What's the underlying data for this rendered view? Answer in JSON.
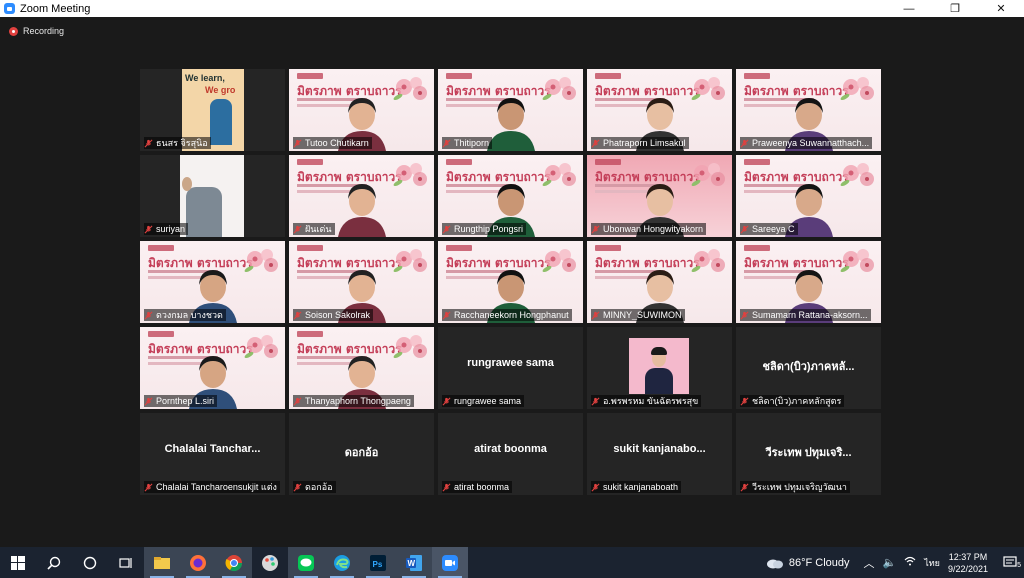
{
  "window": {
    "title": "Zoom Meeting",
    "controls": [
      "—",
      "❐",
      "✕"
    ]
  },
  "meeting": {
    "recording_label": "Recording"
  },
  "slide": {
    "title": "มิตรภาพ ตราบถาวร",
    "tile1_text_1": "We learn,",
    "tile1_text_2": "We gro"
  },
  "participants": [
    {
      "name": "ธนสร จิรสุนิอ",
      "type": "video-banner"
    },
    {
      "name": "Tutoo Chutikarn",
      "type": "slide"
    },
    {
      "name": "Thitiporn",
      "type": "slide"
    },
    {
      "name": "Phatraporn Limsakul",
      "type": "slide"
    },
    {
      "name": "Praweenya Suwannatthach...",
      "type": "slide"
    },
    {
      "name": "suriyan",
      "type": "video-dark"
    },
    {
      "name": "ฝันเด่น",
      "type": "slide"
    },
    {
      "name": "Rungthip  Pongsri",
      "type": "slide"
    },
    {
      "name": "Ubonwan Hongwityakorn",
      "type": "slide-pink"
    },
    {
      "name": "Sareeya C",
      "type": "slide"
    },
    {
      "name": "ดวงกมล บางชวด",
      "type": "slide"
    },
    {
      "name": "Soison Sakolrak",
      "type": "slide"
    },
    {
      "name": "Racchaneekorn Hongphanut",
      "type": "slide"
    },
    {
      "name": "MINNY_SUWIMON",
      "type": "slide"
    },
    {
      "name": "Sumamarn  Rattana-aksorn...",
      "type": "slide"
    },
    {
      "name": "Pornthep L.siri",
      "type": "slide"
    },
    {
      "name": "Thanyaphorn Thongpaeng",
      "type": "slide"
    },
    {
      "name": "rungrawee sama",
      "type": "nocam",
      "display": "rungrawee sama"
    },
    {
      "name": "อ.พรพรหม ขันฉัตรพรสุข",
      "type": "photo"
    },
    {
      "name": "ชลิดา(บิว)ภาคหลักสูตร",
      "type": "nocam",
      "display": "ชลิดา(บิว)ภาคหลั..."
    },
    {
      "name": "Chalalai Tancharoensukjit แต่ง",
      "type": "nocam",
      "display": "Chalalai  Tanchar..."
    },
    {
      "name": "ดอกอ้อ",
      "type": "nocam",
      "display": "ดอกอ้อ"
    },
    {
      "name": "atirat boonma",
      "type": "nocam",
      "display": "atirat boonma"
    },
    {
      "name": "sukit kanjanaboath",
      "type": "nocam",
      "display": "sukit  kanjanabo..."
    },
    {
      "name": "วีระเทพ ปทุมเจริญวัฒนา",
      "type": "nocam",
      "display": "วีระเทพ ปทุมเจริ..."
    }
  ],
  "taskbar": {
    "apps": [
      "windows-start",
      "search",
      "cortana",
      "task-view",
      "file-explorer",
      "firefox",
      "chrome",
      "paint",
      "line",
      "edge",
      "photoshop",
      "word",
      "zoom"
    ],
    "weather": "86°F  Cloudy",
    "language": "ไทย",
    "time": "12:37 PM",
    "date": "9/22/2021",
    "notifications": "5"
  },
  "colors": {
    "muted": "#e0413f",
    "slide_title": "#c43e58",
    "taskbar": "#1b2330",
    "zoom_blue": "#2d8cff"
  }
}
